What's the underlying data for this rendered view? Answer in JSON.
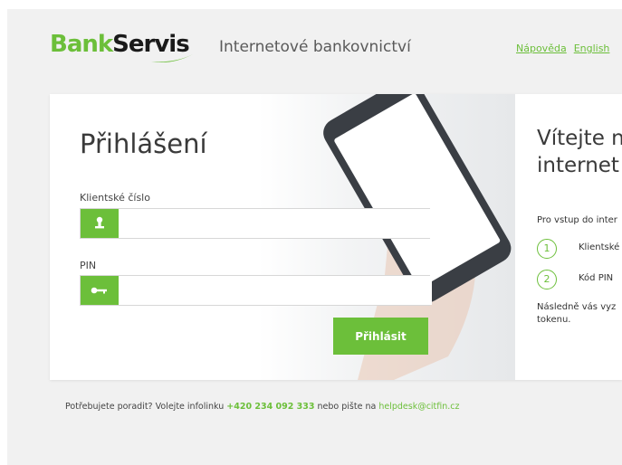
{
  "header": {
    "logo_part1": "Bank",
    "logo_part2": "Servis",
    "tagline": "Internetové bankovnictví",
    "help_link": "Nápověda",
    "lang_link": "English"
  },
  "login": {
    "title": "Přihlášení",
    "client_label": "Klientské číslo",
    "client_value": "",
    "pin_label": "PIN",
    "pin_value": "",
    "submit_label": "Přihlásit"
  },
  "welcome": {
    "title_line1": "Vítejte n",
    "title_line2": "internet",
    "intro": "Pro vstup do inter",
    "steps": [
      {
        "num": "1",
        "text": "Klientské"
      },
      {
        "num": "2",
        "text": "Kód PIN"
      }
    ],
    "outro_line1": "Následně vás vyz",
    "outro_line2": "tokenu."
  },
  "footer": {
    "text_before": "Potřebujete poradit? Volejte infolinku ",
    "phone": "+420 234 092 333",
    "text_middle": " nebo pište na ",
    "email": "helpdesk@citfin.cz"
  },
  "colors": {
    "accent": "#6cbf3a",
    "page_bg": "#f1f1f1"
  },
  "icons": {
    "client_field": "user-icon",
    "pin_field": "key-icon"
  }
}
